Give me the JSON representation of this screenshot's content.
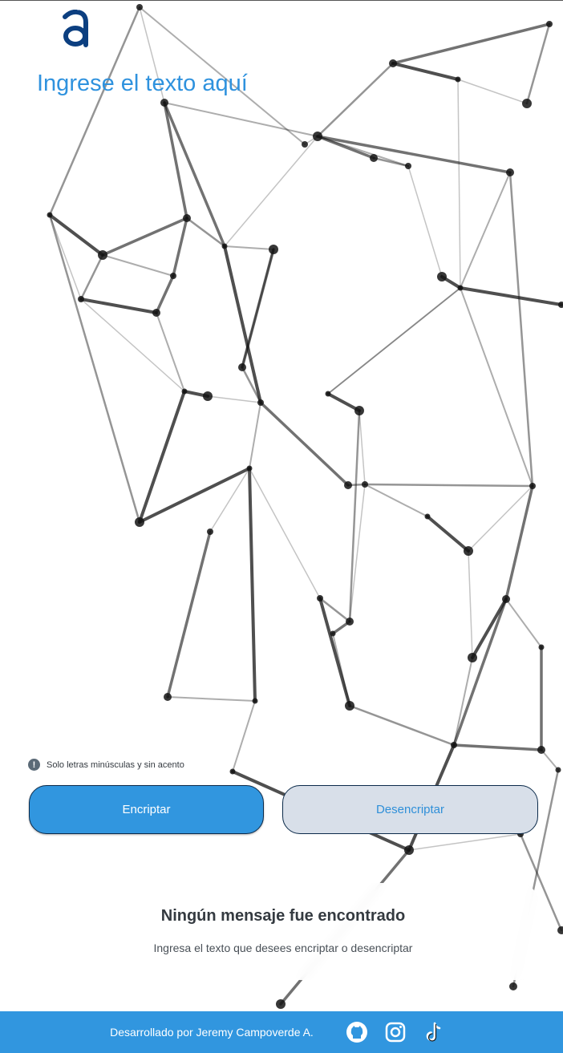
{
  "app": {
    "logo_icon": "alura-logo-icon"
  },
  "input": {
    "placeholder": "Ingrese el texto aquí",
    "value": ""
  },
  "hint": {
    "icon": "info-icon",
    "text": "Solo letras minúsculas y sin acento"
  },
  "buttons": {
    "encrypt": "Encriptar",
    "decrypt": "Desencriptar"
  },
  "output": {
    "title": "Ningún mensaje fue encontrado",
    "text": "Ingresa el texto que desees encriptar o desencriptar"
  },
  "footer": {
    "credit": "Desarrollado por Jeremy Campoverde A.",
    "icons": [
      "github-icon",
      "instagram-icon",
      "tiktok-icon"
    ]
  },
  "colors": {
    "accent": "#3196df",
    "secondary": "#d8dfe9",
    "text_dark": "#343a40"
  }
}
